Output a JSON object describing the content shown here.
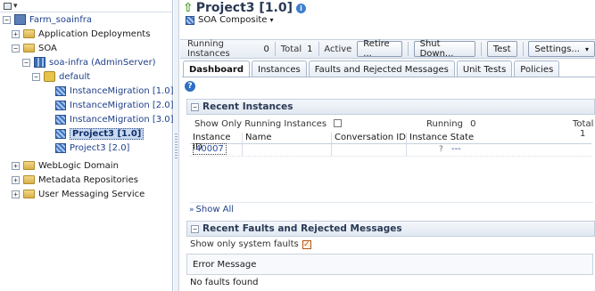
{
  "tree": {
    "farm": "Farm_soainfra",
    "app_deployments": "Application Deployments",
    "soa": "SOA",
    "soa_infra": "soa-infra (AdminServer)",
    "default": "default",
    "composites": [
      "InstanceMigration [1.0]",
      "InstanceMigration [2.0]",
      "InstanceMigration [3.0]",
      "Project3 [1.0]",
      "Project3 [2.0]"
    ],
    "weblogic": "WebLogic Domain",
    "metadata": "Metadata Repositories",
    "ums": "User Messaging Service",
    "expand_open": "−",
    "expand_closed": "+"
  },
  "header": {
    "title": "Project3 [1.0]",
    "info_glyph": "i",
    "soa_menu": "SOA Composite",
    "menu_caret": "▾"
  },
  "toolbar": {
    "running_label": "Running Instances",
    "running_value": "0",
    "total_label": "Total",
    "total_value": "1",
    "state": "Active",
    "retire_button": "Retire ...",
    "shutdown_button": "Shut Down...",
    "test_button": "Test",
    "settings_button": "Settings...",
    "settings_caret": "▾"
  },
  "tabs": [
    "Dashboard",
    "Instances",
    "Faults and Rejected Messages",
    "Unit Tests",
    "Policies"
  ],
  "active_tab": "Dashboard",
  "help_glyph": "?",
  "recent_instances": {
    "heading": "Recent Instances",
    "filter_label": "Show Only Running Instances",
    "running_label": "Running",
    "running_value": "0",
    "total_label": "Total",
    "total_value": "1",
    "columns": [
      "Instance ID",
      "Name",
      "Conversation ID",
      "Instance State"
    ],
    "rows": [
      {
        "id": "40007",
        "name": "",
        "conversation": "",
        "state_icon": "?",
        "state": "---"
      }
    ],
    "show_all": "Show All",
    "show_all_glyph": "»"
  },
  "recent_faults": {
    "heading": "Recent Faults and Rejected Messages",
    "filter_label": "Show only system faults",
    "filter_checked": "✓",
    "column": "Error Message",
    "empty": "No faults found"
  },
  "colors": {
    "accent": "#2a4fa0",
    "title": "#2a3a55",
    "selection": "#c8d8ef"
  }
}
